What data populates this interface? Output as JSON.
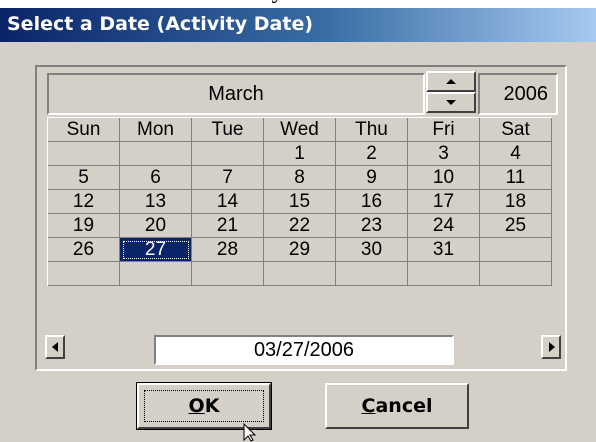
{
  "window": {
    "title": "Select a Date (Activity Date)"
  },
  "calendar": {
    "month": "March",
    "year": "2006",
    "weekdays": [
      "Sun",
      "Mon",
      "Tue",
      "Wed",
      "Thu",
      "Fri",
      "Sat"
    ],
    "weeks": [
      [
        "",
        "",
        "",
        "1",
        "2",
        "3",
        "4"
      ],
      [
        "5",
        "6",
        "7",
        "8",
        "9",
        "10",
        "11"
      ],
      [
        "12",
        "13",
        "14",
        "15",
        "16",
        "17",
        "18"
      ],
      [
        "19",
        "20",
        "21",
        "22",
        "23",
        "24",
        "25"
      ],
      [
        "26",
        "27",
        "28",
        "29",
        "30",
        "31",
        ""
      ],
      [
        "",
        "",
        "",
        "",
        "",
        "",
        ""
      ]
    ],
    "selected_day": "27",
    "selected_date": "03/27/2006",
    "month_up_icon": "arrow-up-icon",
    "month_down_icon": "arrow-down-icon",
    "prev_icon": "arrow-left-icon",
    "next_icon": "arrow-right-icon"
  },
  "buttons": {
    "ok": {
      "accel": "O",
      "rest": "K"
    },
    "cancel": {
      "accel": "C",
      "rest": "ancel"
    }
  },
  "colors": {
    "dialog_bg": "#d4d0c8",
    "title_bar": "#0a246a",
    "selection": "#0a246a"
  }
}
